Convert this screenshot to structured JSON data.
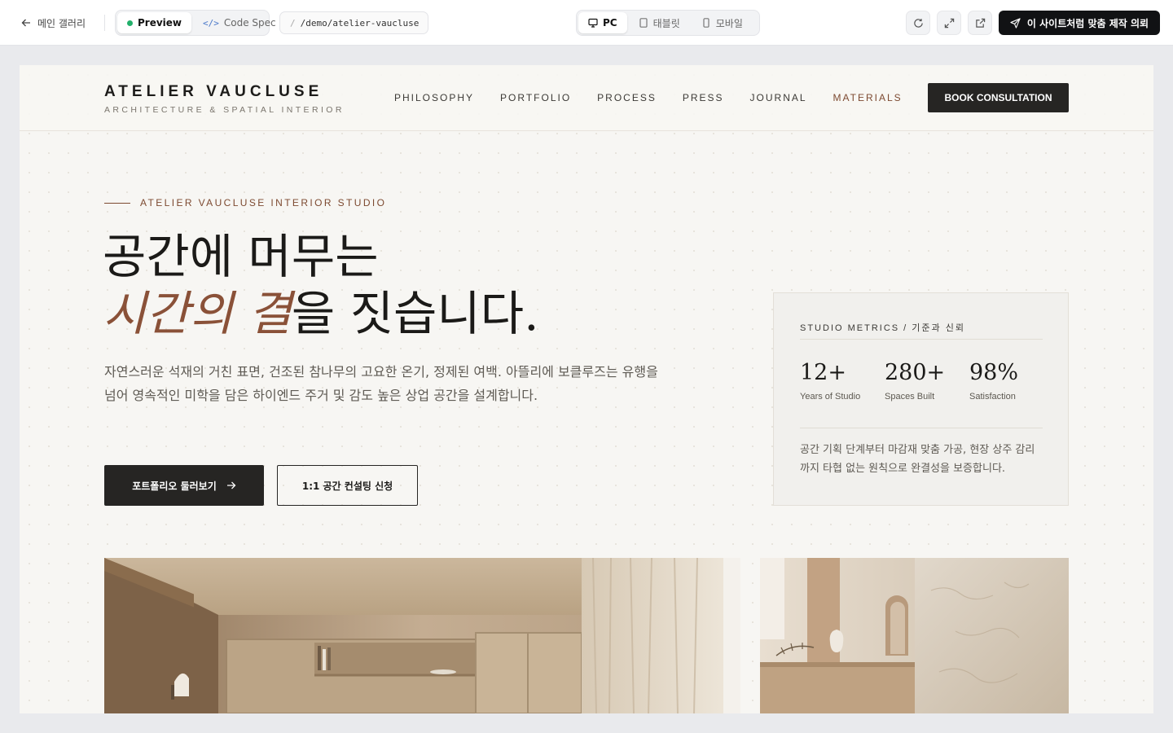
{
  "toolbar": {
    "back_label": "메인 갤러리",
    "tabs": [
      {
        "label": "Preview",
        "active": true
      },
      {
        "label": "Code Spec",
        "active": false
      }
    ],
    "path": "/demo/atelier-vaucluse",
    "devices": [
      {
        "label": "PC",
        "active": true
      },
      {
        "label": "태블릿",
        "active": false
      },
      {
        "label": "모바일",
        "active": false
      }
    ],
    "cta_label": "이 사이트처럼 맞춤 제작 의뢰"
  },
  "site": {
    "brand": {
      "name": "ATELIER VAUCLUSE",
      "tagline": "ARCHITECTURE & SPATIAL INTERIOR"
    },
    "nav": [
      {
        "label": "PHILOSOPHY"
      },
      {
        "label": "PORTFOLIO"
      },
      {
        "label": "PROCESS"
      },
      {
        "label": "PRESS"
      },
      {
        "label": "JOURNAL"
      },
      {
        "label": "MATERIALS"
      }
    ],
    "book_label": "BOOK CONSULTATION",
    "hero": {
      "eyebrow": "ATELIER VAUCLUSE INTERIOR STUDIO",
      "title_line1": "공간에 머무는",
      "title_accent": "시간의 결",
      "title_line2_rest": "을 짓습니다.",
      "description": "자연스러운 석재의 거친 표면, 건조된 참나무의 고요한 온기, 정제된 여백. 아뜰리에 보클루즈는 유행을 넘어 영속적인 미학을 담은 하이엔드 주거 및 감도 높은 상업 공간을 설계합니다.",
      "primary_cta": "포트폴리오 둘러보기",
      "secondary_cta": "1:1 공간 컨설팅 신청"
    },
    "metrics": {
      "label": "STUDIO METRICS / 기준과 신뢰",
      "items": [
        {
          "value": "12+",
          "caption": "Years of Studio"
        },
        {
          "value": "280+",
          "caption": "Spaces Built"
        },
        {
          "value": "98%",
          "caption": "Satisfaction"
        }
      ],
      "note": "공간 기획 단계부터 마감재 맞춤 가공, 현장 상주 감리까지 타협 없는 원칙으로 완결성을 보증합니다."
    }
  },
  "colors": {
    "accent": "#7d4a31",
    "dark": "#262523",
    "page_bg": "#f7f6f3",
    "status_green": "#22b06b"
  }
}
